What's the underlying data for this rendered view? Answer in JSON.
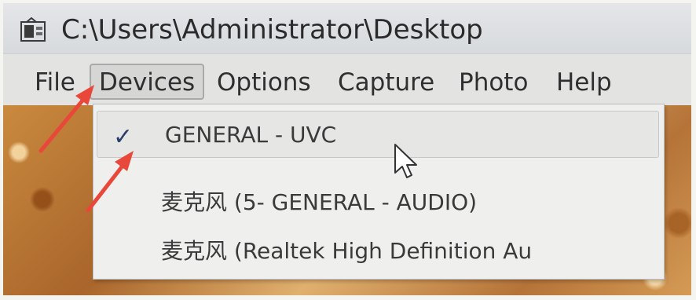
{
  "window": {
    "title": "C:\\Users\\Administrator\\Desktop",
    "icon": "app-window-icon"
  },
  "menubar": {
    "items": [
      {
        "label": "File",
        "active": false
      },
      {
        "label": "Devices",
        "active": true
      },
      {
        "label": "Options",
        "active": false
      },
      {
        "label": "Capture",
        "active": false
      },
      {
        "label": "Photo",
        "active": false
      },
      {
        "label": "Help",
        "active": false
      }
    ]
  },
  "devices_menu": {
    "items": [
      {
        "label": "GENERAL - UVC",
        "checked": true,
        "highlighted": true
      },
      {
        "label": "麦克风 (5- GENERAL - AUDIO)",
        "checked": false,
        "highlighted": false
      },
      {
        "label": "麦克风 (Realtek High Definition Au",
        "checked": false,
        "highlighted": false
      }
    ],
    "check_symbol": "✓"
  },
  "annotations": {
    "arrow_color": "#e8473a"
  },
  "icons": {
    "check": "checkmark-icon",
    "cursor": "mouse-pointer-icon"
  }
}
